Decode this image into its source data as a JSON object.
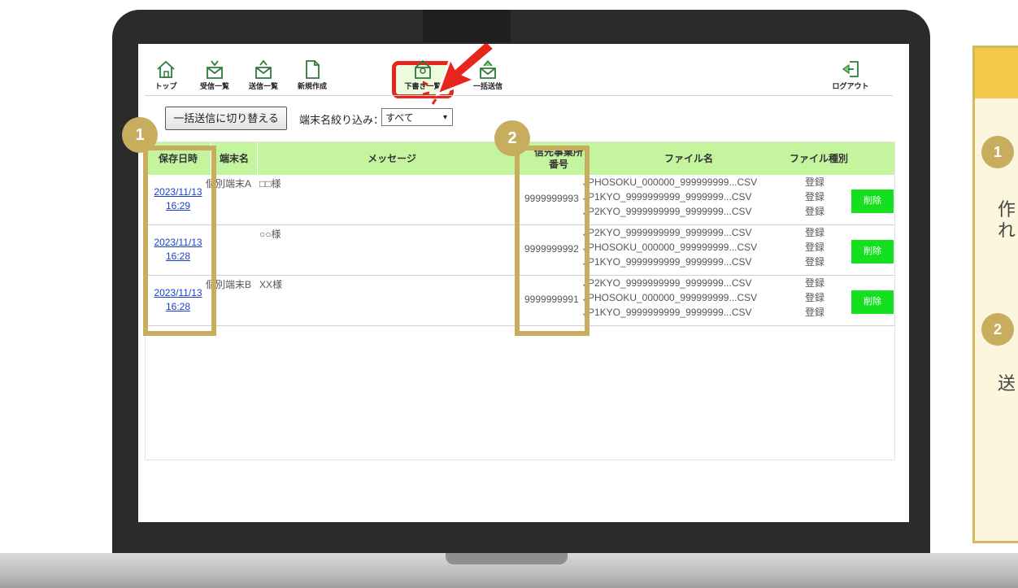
{
  "nav": {
    "items": [
      {
        "label": "トップ",
        "icon": "home-icon"
      },
      {
        "label": "受信一覧",
        "icon": "inbox-icon"
      },
      {
        "label": "送信一覧",
        "icon": "sent-icon"
      },
      {
        "label": "新規作成",
        "icon": "new-document-icon"
      },
      {
        "label": "下書き一覧",
        "icon": "draft-icon"
      },
      {
        "label": "一括送信",
        "icon": "bulk-send-icon"
      }
    ],
    "logout": "ログアウト"
  },
  "toolbar": {
    "switch_label": "一括送信に切り替える",
    "filter_label": "端末名絞り込み：",
    "filter_value": "すべて"
  },
  "table": {
    "headers": [
      "保存日時",
      "端末名",
      "メッセージ",
      "信先事業所\n番号",
      "ファイル名",
      "ファイル種別"
    ],
    "rows": [
      {
        "date": "2023/11/13",
        "time": "16:29",
        "terminal": "個別端末A",
        "message": "□□様",
        "office": "9999999993",
        "files": [
          "JPHOSOKU_000000_999999999...CSV",
          "JP1KYO_9999999999_9999999...CSV",
          "JP2KYO_9999999999_9999999...CSV"
        ],
        "types": [
          "登録",
          "登録",
          "登録"
        ],
        "delete": "削除"
      },
      {
        "date": "2023/11/13",
        "time": "16:28",
        "terminal": "",
        "message": "○○様",
        "office": "9999999992",
        "files": [
          "JP2KYO_9999999999_9999999...CSV",
          "JPHOSOKU_000000_999999999...CSV",
          "JP1KYO_9999999999_9999999...CSV"
        ],
        "types": [
          "登録",
          "登録",
          "登録"
        ],
        "delete": "削除"
      },
      {
        "date": "2023/11/13",
        "time": "16:28",
        "terminal": "個別端末B",
        "message": "XX様",
        "office": "9999999991",
        "files": [
          "JP2KYO_9999999999_9999999...CSV",
          "JPHOSOKU_000000_999999999...CSV",
          "JP1KYO_9999999999_9999999...CSV"
        ],
        "types": [
          "登録",
          "登録",
          "登録"
        ],
        "delete": "削除"
      }
    ]
  },
  "badges": [
    "1",
    "2"
  ],
  "panel": {
    "badge1": "1",
    "text1a": "作",
    "text1b": "れ",
    "badge2": "2",
    "text2": "送"
  },
  "colors": {
    "accent": "#c9ad5f",
    "header_green": "#c5f49f",
    "delete_green": "#14e01d",
    "highlight_red": "#e8251c",
    "link": "#1a3fc7"
  }
}
